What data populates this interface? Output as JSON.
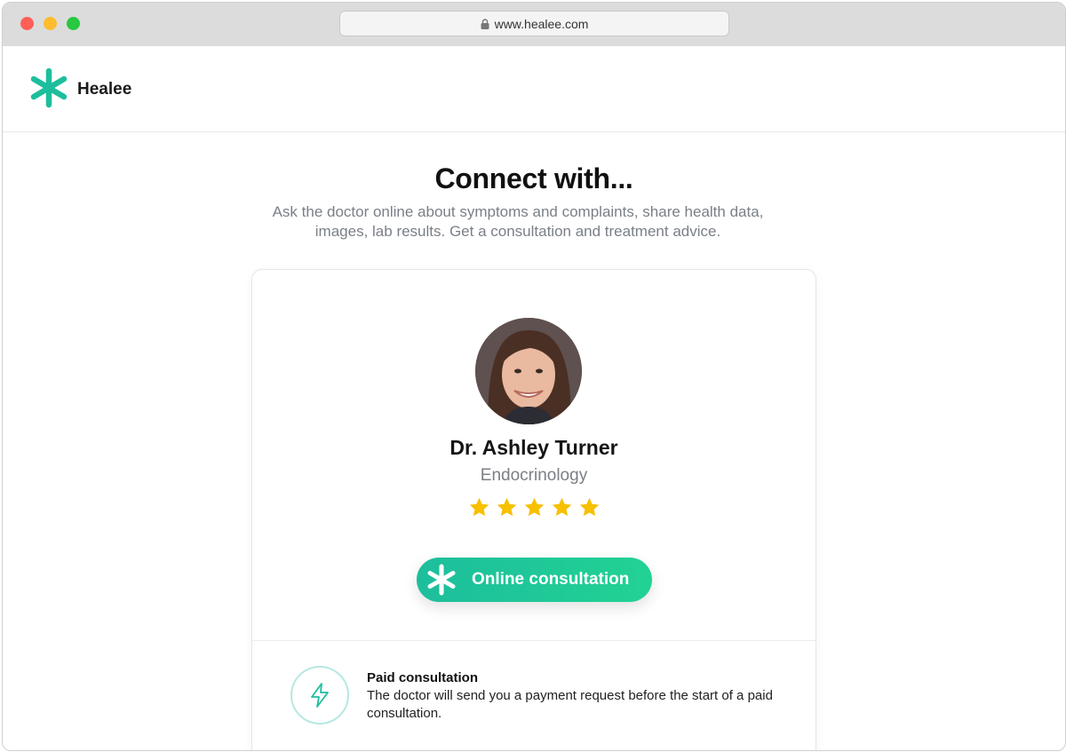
{
  "browser": {
    "url": "www.healee.com"
  },
  "header": {
    "brand": "Healee",
    "brand_color": "#1dbe9c"
  },
  "hero": {
    "title": "Connect with...",
    "subtitle": "Ask the doctor online about symptoms and complaints, share health data, images, lab results. Get a consultation and treatment advice."
  },
  "doctor": {
    "name": "Dr. Ashley Turner",
    "specialty": "Endocrinology",
    "rating": 5,
    "rating_max": 5,
    "star_color": "#f7c000"
  },
  "cta": {
    "label": "Online consultation",
    "icon": "asterisk-icon"
  },
  "paid": {
    "title": "Paid consultation",
    "description": "The doctor will send you a payment request before the start of a paid consultation.",
    "icon": "lightning-icon"
  }
}
